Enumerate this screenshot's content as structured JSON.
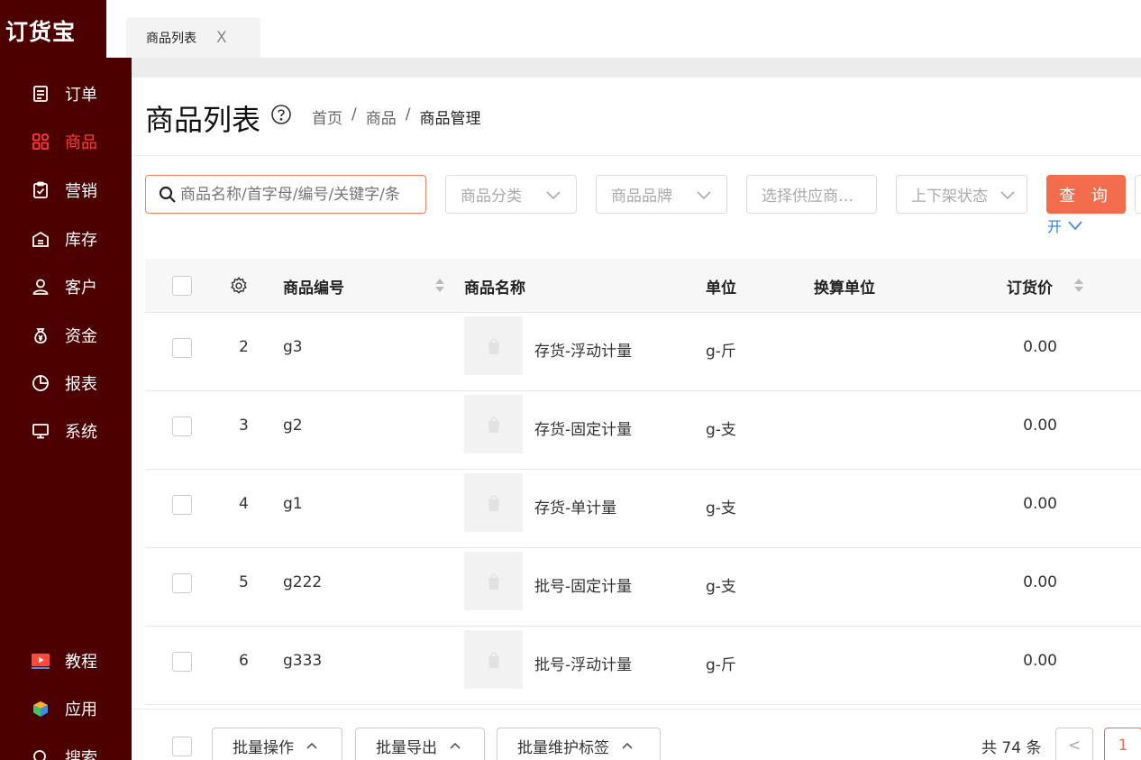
{
  "app": {
    "logo": "订货宝"
  },
  "sidebar": {
    "items": [
      {
        "label": "订单",
        "icon": "order-icon"
      },
      {
        "label": "商品",
        "icon": "goods-icon",
        "active": true
      },
      {
        "label": "营销",
        "icon": "marketing-icon"
      },
      {
        "label": "库存",
        "icon": "warehouse-icon"
      },
      {
        "label": "客户",
        "icon": "customer-icon"
      },
      {
        "label": "资金",
        "icon": "money-bag-icon"
      },
      {
        "label": "报表",
        "icon": "pie-chart-icon"
      },
      {
        "label": "系统",
        "icon": "monitor-icon"
      }
    ],
    "bottom": [
      {
        "label": "教程",
        "icon": "video-play-icon"
      },
      {
        "label": "应用",
        "icon": "cube-icon"
      },
      {
        "label": "搜索",
        "icon": "search-icon"
      }
    ]
  },
  "tabs": [
    {
      "label": "商品列表",
      "close": "X"
    }
  ],
  "header": {
    "title": "商品列表",
    "breadcrumb": [
      "首页",
      "/",
      "商品",
      "/",
      "商品管理"
    ]
  },
  "filters": {
    "search_placeholder": "商品名称/首字母/编号/关键字/条",
    "category": "商品分类",
    "brand": "商品品牌",
    "supplier": "选择供应商…",
    "status": "上下架状态",
    "query_label": "查 询",
    "expand_label": "开"
  },
  "table": {
    "columns": {
      "code": "商品编号",
      "name": "商品名称",
      "unit": "单位",
      "conv_unit": "换算单位",
      "price": "订货价"
    },
    "rows": [
      {
        "idx": "2",
        "code": "g3",
        "name": "存货-浮动计量",
        "unit": "g-斤",
        "price": "0.00"
      },
      {
        "idx": "3",
        "code": "g2",
        "name": "存货-固定计量",
        "unit": "g-支",
        "price": "0.00"
      },
      {
        "idx": "4",
        "code": "g1",
        "name": "存货-单计量",
        "unit": "g-支",
        "price": "0.00"
      },
      {
        "idx": "5",
        "code": "g222",
        "name": "批号-固定计量",
        "unit": "g-支",
        "price": "0.00"
      },
      {
        "idx": "6",
        "code": "g333",
        "name": "批号-浮动计量",
        "unit": "g-斤",
        "price": "0.00"
      }
    ]
  },
  "footer": {
    "batch_ops": "批量操作",
    "batch_export": "批量导出",
    "batch_tags": "批量维护标签",
    "total": "共 74 条",
    "prev": "<",
    "page": "1"
  },
  "colors": {
    "sidebar_bg": "#4d0000",
    "accent": "#f46c4e",
    "active_nav": "#ff3b3b",
    "link": "#2a7fe0"
  }
}
